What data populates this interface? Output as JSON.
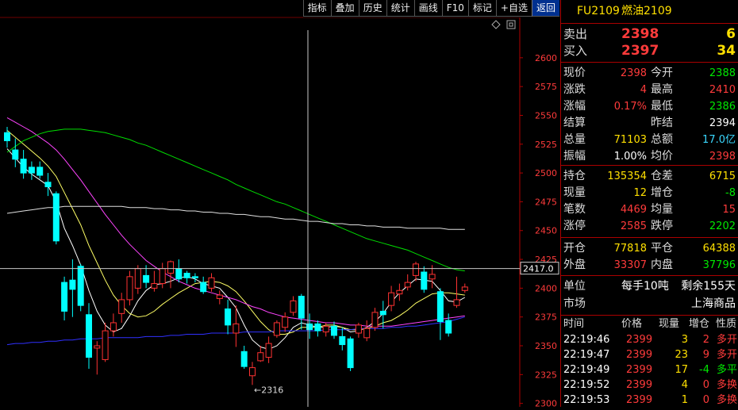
{
  "toolbar": {
    "buttons": [
      "指标",
      "叠加",
      "历史",
      "统计",
      "画线",
      "F10",
      "标记",
      "+自选",
      "返回"
    ]
  },
  "quote": {
    "code": "FU2109",
    "name": "燃油2109",
    "sell_label": "卖出",
    "sell_price": "2398",
    "sell_vol": "6",
    "buy_label": "买入",
    "buy_price": "2397",
    "buy_vol": "34",
    "stats": [
      {
        "l1": "现价",
        "v1": "2398",
        "c1": "red",
        "l2": "今开",
        "v2": "2388",
        "c2": "grn"
      },
      {
        "l1": "涨跌",
        "v1": "4",
        "c1": "red",
        "l2": "最高",
        "v2": "2410",
        "c2": "red"
      },
      {
        "l1": "涨幅",
        "v1": "0.17%",
        "c1": "red",
        "l2": "最低",
        "v2": "2386",
        "c2": "grn"
      },
      {
        "l1": "结算",
        "v1": "",
        "c1": "wht",
        "l2": "昨结",
        "v2": "2394",
        "c2": "wht"
      },
      {
        "l1": "总量",
        "v1": "71103",
        "c1": "yel",
        "l2": "总额",
        "v2": "17.0亿",
        "c2": "cyn"
      },
      {
        "l1": "振幅",
        "v1": "1.00%",
        "c1": "wht",
        "l2": "均价",
        "v2": "2398",
        "c2": "red"
      }
    ],
    "stats2": [
      {
        "l1": "持仓",
        "v1": "135354",
        "c1": "yel",
        "l2": "仓差",
        "v2": "6715",
        "c2": "yel"
      },
      {
        "l1": "现量",
        "v1": "12",
        "c1": "yel",
        "l2": "增仓",
        "v2": "-8",
        "c2": "grn"
      },
      {
        "l1": "笔数",
        "v1": "4469",
        "c1": "red",
        "l2": "均量",
        "v2": "15",
        "c2": "red"
      },
      {
        "l1": "涨停",
        "v1": "2585",
        "c1": "red",
        "l2": "跌停",
        "v2": "2202",
        "c2": "grn"
      }
    ],
    "stats3": [
      {
        "l1": "开仓",
        "v1": "77818",
        "c1": "yel",
        "l2": "平仓",
        "v2": "64388",
        "c2": "yel"
      },
      {
        "l1": "外盘",
        "v1": "33307",
        "c1": "red",
        "l2": "内盘",
        "v2": "37796",
        "c2": "grn"
      }
    ],
    "unit_label": "单位",
    "unit_value": "每手10吨",
    "remain_label": "剩余155天",
    "market_label": "市场",
    "market_value": "上海商品",
    "tick_headers": [
      "时间",
      "价格",
      "现量",
      "增仓",
      "性质"
    ],
    "ticks": [
      {
        "time": "22:19:46",
        "price": "2399",
        "vol": "3",
        "chg": "2",
        "chg_c": "red",
        "nature": "多开",
        "nat_c": "red"
      },
      {
        "time": "22:19:47",
        "price": "2399",
        "vol": "23",
        "chg": "9",
        "chg_c": "red",
        "nature": "多开",
        "nat_c": "red"
      },
      {
        "time": "22:19:49",
        "price": "2399",
        "vol": "17",
        "chg": "-4",
        "chg_c": "grn",
        "nature": "多平",
        "nat_c": "grn"
      },
      {
        "time": "22:19:52",
        "price": "2399",
        "vol": "4",
        "chg": "0",
        "chg_c": "red",
        "nature": "多换",
        "nat_c": "red"
      },
      {
        "time": "22:19:53",
        "price": "2399",
        "vol": "1",
        "chg": "0",
        "chg_c": "red",
        "nature": "多换",
        "nat_c": "red"
      }
    ]
  },
  "chart_data": {
    "type": "candlestick",
    "y_ticks": [
      2300,
      2325,
      2350,
      2375,
      2400,
      2425,
      2450,
      2475,
      2500,
      2525,
      2550,
      2575,
      2600
    ],
    "ylim": [
      2297,
      2635
    ],
    "crosshair_price": "2417.0",
    "low_annotation": "2316",
    "colors": {
      "up": "#ff3232",
      "down": "#00ffff",
      "ma1": "#ffffff",
      "ma2": "#ffff66",
      "ma3": "#ff44ff",
      "ma4": "#00dd00",
      "ma5": "#e0e0e0",
      "ma6": "#3030ff",
      "grid": "#700000",
      "crosshair": "#c8c8c8"
    },
    "candles": [
      [
        2535,
        2528,
        2540,
        2522
      ],
      [
        2520,
        2512,
        2530,
        2505
      ],
      [
        2512,
        2500,
        2520,
        2495
      ],
      [
        2505,
        2500,
        2510,
        2494
      ],
      [
        2505,
        2498,
        2510,
        2495
      ],
      [
        2492,
        2488,
        2500,
        2480
      ],
      [
        2482,
        2441,
        2484,
        2438
      ],
      [
        2405,
        2380,
        2410,
        2372
      ],
      [
        2407,
        2399,
        2425,
        2375
      ],
      [
        2419,
        2385,
        2421,
        2380
      ],
      [
        2377,
        2340,
        2387,
        2330
      ],
      [
        2348,
        2350,
        2354,
        2325
      ],
      [
        2338,
        2363,
        2370,
        2336
      ],
      [
        2363,
        2370,
        2378,
        2358
      ],
      [
        2378,
        2390,
        2396,
        2370
      ],
      [
        2390,
        2410,
        2415,
        2385
      ],
      [
        2400,
        2417,
        2420,
        2395
      ],
      [
        2411,
        2405,
        2420,
        2400
      ],
      [
        2400,
        2404,
        2415,
        2397
      ],
      [
        2404,
        2417,
        2422,
        2400
      ],
      [
        2413,
        2423,
        2424,
        2400
      ],
      [
        2417,
        2408,
        2425,
        2405
      ],
      [
        2413,
        2409,
        2415,
        2404
      ],
      [
        2410,
        2409,
        2413,
        2405
      ],
      [
        2405,
        2397,
        2410,
        2395
      ],
      [
        2400,
        2409,
        2413,
        2397
      ],
      [
        2391,
        2394,
        2398,
        2386
      ],
      [
        2382,
        2368,
        2390,
        2360
      ],
      [
        2361,
        2369,
        2385,
        2349
      ],
      [
        2345,
        2332,
        2350,
        2330
      ],
      [
        2324,
        2331,
        2336,
        2316
      ],
      [
        2337,
        2344,
        2350,
        2336
      ],
      [
        2340,
        2352,
        2358,
        2335
      ],
      [
        2359,
        2370,
        2372,
        2357
      ],
      [
        2366,
        2375,
        2379,
        2362
      ],
      [
        2379,
        2389,
        2393,
        2376
      ],
      [
        2393,
        2374,
        2395,
        2364
      ],
      [
        2369,
        2364,
        2378,
        2356
      ],
      [
        2369,
        2363,
        2372,
        2358
      ],
      [
        2362,
        2367,
        2370,
        2358
      ],
      [
        2367,
        2359,
        2371,
        2356
      ],
      [
        2358,
        2351,
        2366,
        2346
      ],
      [
        2356,
        2331,
        2358,
        2328
      ],
      [
        2361,
        2368,
        2370,
        2357
      ],
      [
        2357,
        2365,
        2372,
        2354
      ],
      [
        2366,
        2379,
        2383,
        2363
      ],
      [
        2380,
        2377,
        2389,
        2365
      ],
      [
        2385,
        2396,
        2402,
        2380
      ],
      [
        2395,
        2398,
        2404,
        2389
      ],
      [
        2401,
        2405,
        2412,
        2398
      ],
      [
        2411,
        2421,
        2423,
        2406
      ],
      [
        2414,
        2399,
        2419,
        2396
      ],
      [
        2408,
        2412,
        2420,
        2400
      ],
      [
        2397,
        2371,
        2400,
        2355
      ],
      [
        2372,
        2361,
        2378,
        2358
      ],
      [
        2385,
        2390,
        2410,
        2383
      ],
      [
        2398,
        2401,
        2404,
        2396
      ]
    ],
    "ma_series": [
      {
        "name": "ma1",
        "values": [
          2521,
          2513,
          2505,
          2499,
          2494,
          2489,
          2475,
          2452,
          2437,
          2420,
          2398,
          2380,
          2368,
          2362,
          2365,
          2376,
          2389,
          2398,
          2403,
          2404,
          2406,
          2409,
          2410,
          2408,
          2404,
          2402,
          2400,
          2392,
          2383,
          2368,
          2355,
          2349,
          2347,
          2350,
          2357,
          2366,
          2370,
          2368,
          2366,
          2366,
          2367,
          2366,
          2362,
          2363,
          2366,
          2371,
          2378,
          2388,
          2396,
          2402,
          2408,
          2407,
          2406,
          2398,
          2389,
          2388,
          2392
        ]
      },
      {
        "name": "ma2",
        "values": [
          2537,
          2531,
          2525,
          2519,
          2513,
          2506,
          2497,
          2483,
          2469,
          2455,
          2437,
          2422,
          2407,
          2394,
          2385,
          2378,
          2375,
          2376,
          2380,
          2386,
          2391,
          2396,
          2400,
          2404,
          2405,
          2406,
          2405,
          2402,
          2397,
          2389,
          2380,
          2371,
          2364,
          2360,
          2360,
          2362,
          2366,
          2366,
          2366,
          2368,
          2368,
          2366,
          2364,
          2364,
          2365,
          2367,
          2370,
          2372,
          2376,
          2381,
          2387,
          2391,
          2395,
          2396,
          2396,
          2395,
          2394
        ]
      },
      {
        "name": "ma3",
        "values": [
          2548,
          2544,
          2540,
          2536,
          2531,
          2526,
          2520,
          2512,
          2503,
          2494,
          2484,
          2474,
          2464,
          2455,
          2446,
          2438,
          2431,
          2424,
          2419,
          2414,
          2410,
          2406,
          2403,
          2400,
          2398,
          2396,
          2394,
          2392,
          2390,
          2387,
          2384,
          2382,
          2379,
          2377,
          2375,
          2374,
          2373,
          2372,
          2371,
          2370,
          2370,
          2369,
          2368,
          2368,
          2367,
          2367,
          2367,
          2367,
          2368,
          2369,
          2370,
          2371,
          2372,
          2373,
          2374,
          2375,
          2376
        ]
      },
      {
        "name": "ma4",
        "values": [
          2518,
          2523,
          2528,
          2531,
          2534,
          2536,
          2537,
          2538,
          2538,
          2538,
          2537,
          2536,
          2535,
          2533,
          2531,
          2529,
          2526,
          2524,
          2521,
          2518,
          2515,
          2512,
          2509,
          2506,
          2503,
          2500,
          2497,
          2494,
          2490,
          2487,
          2484,
          2481,
          2478,
          2475,
          2473,
          2470,
          2467,
          2464,
          2461,
          2458,
          2455,
          2452,
          2449,
          2446,
          2443,
          2441,
          2439,
          2437,
          2435,
          2433,
          2430,
          2427,
          2424,
          2421,
          2418,
          2416,
          2415
        ]
      },
      {
        "name": "ma5",
        "values": [
          2465,
          2466,
          2467,
          2468,
          2469,
          2470,
          2470,
          2471,
          2471,
          2471,
          2471,
          2471,
          2471,
          2471,
          2471,
          2470,
          2470,
          2470,
          2469,
          2469,
          2468,
          2468,
          2467,
          2467,
          2466,
          2466,
          2465,
          2465,
          2464,
          2464,
          2463,
          2462,
          2462,
          2461,
          2460,
          2460,
          2459,
          2458,
          2458,
          2457,
          2456,
          2456,
          2455,
          2455,
          2454,
          2454,
          2453,
          2453,
          2453,
          2452,
          2452,
          2452,
          2452,
          2452,
          2451,
          2451,
          2451
        ]
      },
      {
        "name": "ma6",
        "values": [
          2351,
          2352,
          2352,
          2353,
          2353,
          2354,
          2354,
          2355,
          2355,
          2356,
          2356,
          2356,
          2357,
          2357,
          2357,
          2357,
          2357,
          2358,
          2358,
          2358,
          2359,
          2359,
          2360,
          2360,
          2360,
          2361,
          2361,
          2361,
          2361,
          2362,
          2362,
          2362,
          2362,
          2363,
          2363,
          2363,
          2363,
          2363,
          2363,
          2364,
          2364,
          2364,
          2364,
          2365,
          2365,
          2365,
          2365,
          2366,
          2366,
          2367,
          2367,
          2368,
          2369,
          2370,
          2371,
          2373,
          2375
        ]
      }
    ]
  }
}
